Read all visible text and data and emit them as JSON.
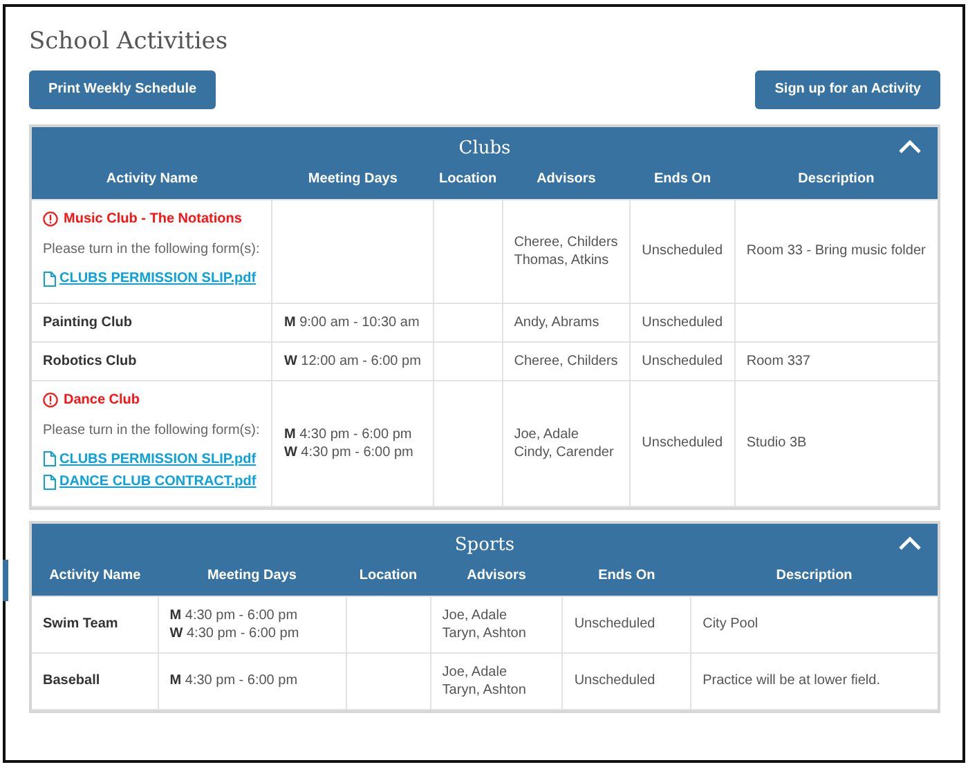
{
  "page": {
    "title": "School Activities"
  },
  "buttons": [
    {
      "label": "Print Weekly Schedule"
    },
    {
      "label": "Sign up for an Activity"
    }
  ],
  "sections": [
    {
      "title": "Clubs",
      "expanded": true,
      "columns": [
        "Activity Name",
        "Meeting Days",
        "Location",
        "Advisors",
        "Ends On",
        "Description"
      ],
      "rows": [
        {
          "name": "Music Club - The Notations",
          "alert": true,
          "forms_prompt": "Please turn in the following form(s):",
          "forms": [
            "CLUBS PERMISSION SLIP.pdf"
          ],
          "meeting": [],
          "location": "",
          "advisors": [
            "Cheree, Childers",
            "Thomas, Atkins"
          ],
          "ends_on": "Unscheduled",
          "description": "Room 33 - Bring music folder"
        },
        {
          "name": "Painting Club",
          "alert": false,
          "meeting": [
            "**M** 9:00 am - 10:30 am"
          ],
          "location": "",
          "advisors": [
            "Andy, Abrams"
          ],
          "ends_on": "Unscheduled",
          "description": ""
        },
        {
          "name": "Robotics Club",
          "alert": false,
          "meeting": [
            "**W** 12:00 am - 6:00 pm"
          ],
          "location": "",
          "advisors": [
            "Cheree, Childers"
          ],
          "ends_on": "Unscheduled",
          "description": "Room 337"
        },
        {
          "name": "Dance Club",
          "alert": true,
          "forms_prompt": "Please turn in the following form(s):",
          "forms": [
            "CLUBS PERMISSION SLIP.pdf",
            "DANCE CLUB CONTRACT.pdf"
          ],
          "meeting": [
            "**M** 4:30 pm - 6:00 pm",
            "**W** 4:30 pm - 6:00 pm"
          ],
          "location": "",
          "advisors": [
            "Joe, Adale",
            "Cindy, Carender"
          ],
          "ends_on": "Unscheduled",
          "description": "Studio 3B"
        }
      ]
    },
    {
      "title": "Sports",
      "expanded": true,
      "columns": [
        "Activity Name",
        "Meeting Days",
        "Location",
        "Advisors",
        "Ends On",
        "Description"
      ],
      "rows": [
        {
          "name": "Swim Team",
          "alert": false,
          "meeting": [
            "**M** 4:30 pm - 6:00 pm",
            "**W** 4:30 pm - 6:00 pm"
          ],
          "location": "",
          "advisors": [
            "Joe, Adale",
            "Taryn, Ashton"
          ],
          "ends_on": "Unscheduled",
          "description": "City Pool"
        },
        {
          "name": "Baseball",
          "alert": false,
          "meeting": [
            "**M** 4:30 pm - 6:00 pm"
          ],
          "location": "",
          "advisors": [
            "Joe, Adale",
            "Taryn, Ashton"
          ],
          "ends_on": "Unscheduled",
          "description": "Practice will be at lower field."
        }
      ]
    }
  ]
}
